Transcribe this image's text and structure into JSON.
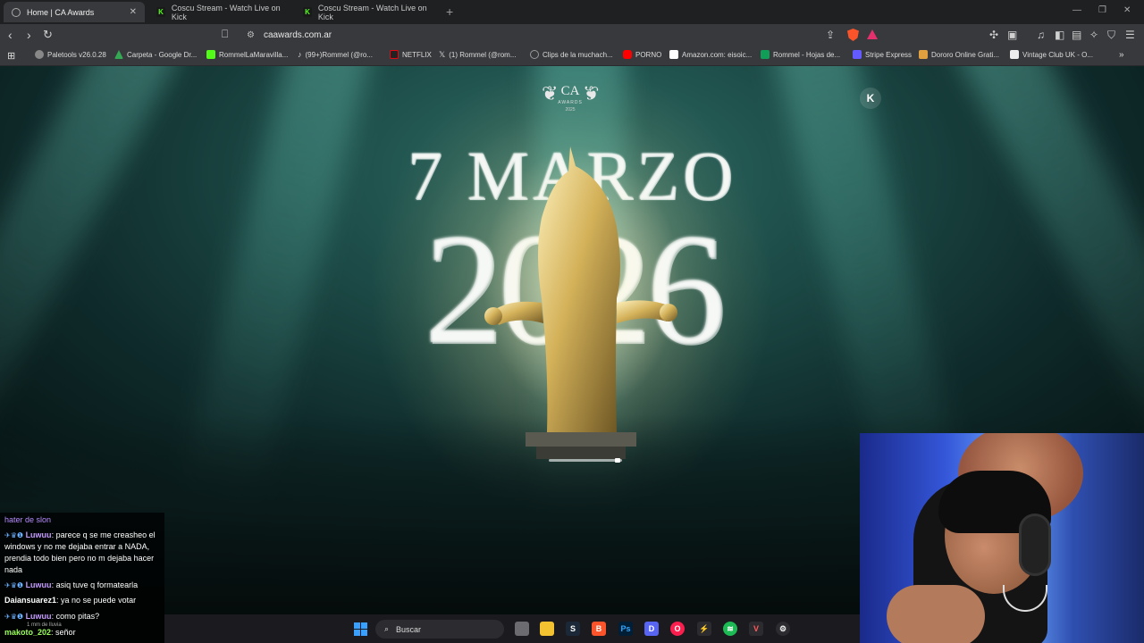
{
  "tabs": [
    {
      "title": "Home | CA Awards",
      "active": true
    },
    {
      "title": "Coscu Stream - Watch Live on Kick",
      "active": false
    },
    {
      "title": "Coscu Stream - Watch Live on Kick",
      "active": false
    }
  ],
  "address": {
    "url": "caawards.com.ar"
  },
  "bookmarks": [
    {
      "label": "Paletools v26.0.28",
      "color": "#888888"
    },
    {
      "label": "Carpeta - Google Dr...",
      "color": "#34a853"
    },
    {
      "label": "RommelLaMaravilla...",
      "color": "#53fc18"
    },
    {
      "label": "(99+)Rommel (@ro...",
      "color": "#ffffff"
    },
    {
      "label": "NETFLIX",
      "color": "#e50914"
    },
    {
      "label": "(1) Rommel (@rom...",
      "color": "#ffffff"
    },
    {
      "label": "Clips de la muchach...",
      "color": "#999999"
    },
    {
      "label": "PORNO",
      "color": "#ff0000"
    },
    {
      "label": "Amazon.com: eisoic...",
      "color": "#ffffff"
    },
    {
      "label": "Rommel - Hojas de...",
      "color": "#0f9d58"
    },
    {
      "label": "Stripe Express",
      "color": "#635bff"
    },
    {
      "label": "Dororo Online Grati...",
      "color": "#e0a040"
    },
    {
      "label": "Vintage Club UK - O...",
      "color": "#eeeeee"
    }
  ],
  "hero": {
    "logo_text": "CA",
    "logo_sub": "AWARDS",
    "logo_year": "2025",
    "date": "7 MARZO",
    "year": "2026"
  },
  "chat": [
    {
      "user": "",
      "text": "hater de slon",
      "partial": true
    },
    {
      "user": "Luwuu",
      "text": "parece q se me creasheo el windows y no me dejaba entrar a NADA, prendia todo bien pero no m dejaba hacer nada",
      "color": "#c69cff"
    },
    {
      "user": "Luwuu",
      "text": "asiq tuve q formatearla",
      "color": "#c69cff"
    },
    {
      "user": "Daiansuarez1",
      "text": "ya no se puede votar",
      "color": "#ffffff"
    },
    {
      "user": "Luwuu",
      "text": "como pitas?",
      "color": "#c69cff"
    },
    {
      "user": "makoto_202",
      "text": "señor",
      "color": "#9aff5a"
    }
  ],
  "taskbar": {
    "search_label": "Buscar",
    "weather": "1 mm de lluvia"
  },
  "colors": {
    "accent_kick": "#53fc18",
    "page_teal": "#2d6a63"
  }
}
